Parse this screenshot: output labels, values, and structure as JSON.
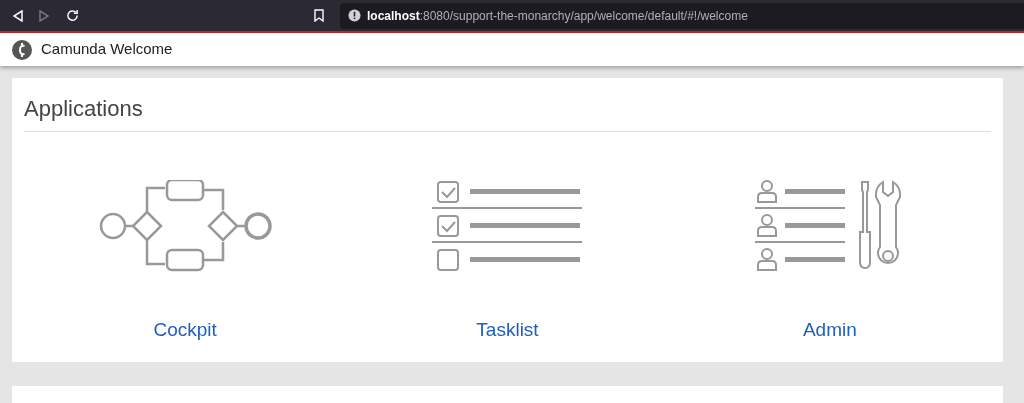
{
  "browser": {
    "url": "**localhost**:8080/support-the-monarchy/app/welcome/default/#!/welcome"
  },
  "header": {
    "title": "Camunda Welcome"
  },
  "applications": {
    "title": "Applications",
    "items": [
      {
        "kind": "cockpit",
        "label": "Cockpit"
      },
      {
        "kind": "tasklist",
        "label": "Tasklist"
      },
      {
        "kind": "admin",
        "label": "Admin"
      }
    ]
  }
}
